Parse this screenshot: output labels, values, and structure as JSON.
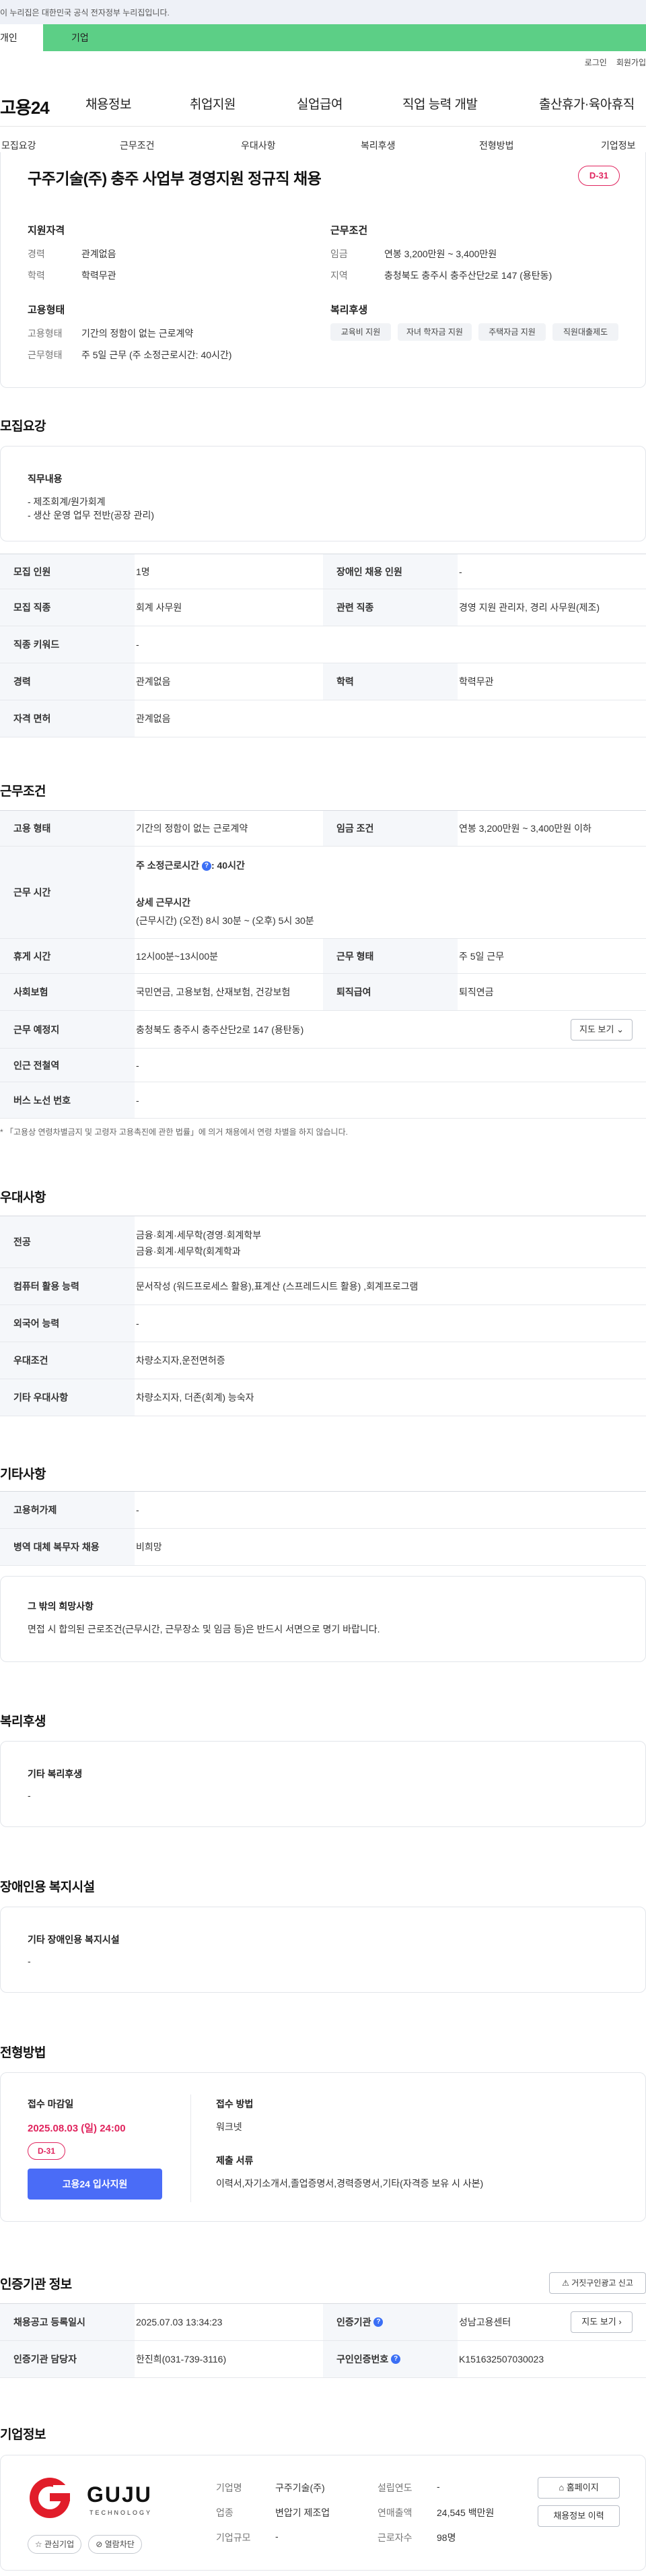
{
  "gov_banner": "이 누리집은 대한민국 공식 전자정부 누리집입니다.",
  "user_tabs": [
    "개인",
    "기업"
  ],
  "util_links": [
    "로그인",
    "회원가입"
  ],
  "logo": "고용24",
  "gnb": [
    "채용정보",
    "취업지원",
    "실업급여",
    "직업 능력 개발",
    "출산휴가·육아휴직"
  ],
  "subnav": [
    "모집요강",
    "근무조건",
    "우대사항",
    "복리후생",
    "전형방법",
    "기업정보"
  ],
  "job": {
    "title": "구주기술(주) 충주 사업부 경영지원 정규직 채용",
    "dday": "D-31",
    "qual_title": "지원자격",
    "qual": [
      {
        "k": "경력",
        "v": "관계없음"
      },
      {
        "k": "학력",
        "v": "학력무관"
      }
    ],
    "emp_title": "고용형태",
    "emp": [
      {
        "k": "고용형태",
        "v": "기간의 정함이 없는 근로계약"
      },
      {
        "k": "근무형태",
        "v": "주 5일 근무 (주 소정근로시간: 40시간)"
      }
    ],
    "cond_title": "근무조건",
    "cond": [
      {
        "k": "임금",
        "v": "연봉 3,200만원 ~ 3,400만원"
      },
      {
        "k": "지역",
        "v": "충청북도 충주시 충주산단2로 147 (용탄동)"
      }
    ],
    "welfare_title": "복리후생",
    "welfare_chips": [
      "교육비 지원",
      "자녀 학자금 지원",
      "주택자금 지원",
      "직원대출제도"
    ]
  },
  "recruit": {
    "heading": "모집요강",
    "duty_title": "직무내용",
    "duty_lines": [
      "- 제조회계/원가회계",
      "- 생산 운영 업무 전반(공장 관리)"
    ],
    "rows": [
      {
        "k1": "모집 인원",
        "v1": "1명",
        "k2": "장애인 채용 인원",
        "v2": "-"
      },
      {
        "k1": "모집 직종",
        "v1": "회계 사무원",
        "k2": "관련 직종",
        "v2": "경영 지원 관리자, 경리 사무원(제조)"
      },
      {
        "k1": "직종 키워드",
        "v1": "-"
      },
      {
        "k1": "경력",
        "v1": "관계없음",
        "k2": "학력",
        "v2": "학력무관"
      },
      {
        "k1": "자격 면허",
        "v1": "관계없음"
      }
    ]
  },
  "work": {
    "heading": "근무조건",
    "emp_type_k": "고용 형태",
    "emp_type_v": "기간의 정함이 없는 근로계약",
    "wage_k": "임금 조건",
    "wage_v": "연봉 3,200만원 ~ 3,400만원 이하",
    "hours_k": "근무 시간",
    "hours_l1": "주 소정근로시간",
    "hours_l1_v": ": 40시간",
    "hours_l2": "상세 근무시간",
    "hours_l3": "(근무시간) (오전) 8시 30분 ~ (오후) 5시 30분",
    "rest_k": "휴게 시간",
    "rest_v": "12시00분~13시00분",
    "form_k": "근무 형태",
    "form_v": "주 5일 근무",
    "ins_k": "사회보험",
    "ins_v": "국민연금, 고용보험, 산재보험, 건강보험",
    "ret_k": "퇴직급여",
    "ret_v": "퇴직연금",
    "place_k": "근무 예정지",
    "place_v": "충청북도 충주시 충주산단2로 147 (용탄동)",
    "map_btn": "지도 보기",
    "sub_k": "인근 전철역",
    "sub_v": "-",
    "bus_k": "버스 노선 번호",
    "bus_v": "-",
    "note": "「고용상 연령차별금지 및 고령자 고용촉진에 관한 법률」에 의거 채용에서 연령 차별을 하지 않습니다."
  },
  "pref": {
    "heading": "우대사항",
    "rows": [
      {
        "k": "전공",
        "v": "금융·회계·세무학(경영·회계학부",
        "v2": "금융·회계·세무학(회계학과"
      },
      {
        "k": "컴퓨터 활용 능력",
        "v": "문서작성 (워드프로세스 활용),표계산 (스프레드시트 활용) ,회계프로그램"
      },
      {
        "k": "외국어 능력",
        "v": "-"
      },
      {
        "k": "우대조건",
        "v": "차량소지자,운전면허증"
      },
      {
        "k": "기타 우대사항",
        "v": "차량소지자, 더존(회계) 능숙자"
      }
    ]
  },
  "etc": {
    "heading": "기타사항",
    "rows": [
      {
        "k": "고용허가제",
        "v": "-"
      },
      {
        "k": "병역 대체 복무자 채용",
        "v": "비희망"
      }
    ],
    "box_title": "그 밖의 희망사항",
    "box_text": "면접 시 합의된 근로조건(근무시간, 근무장소 및 임금 등)은 반드시 서면으로 명기 바랍니다."
  },
  "welfare": {
    "heading": "복리후생",
    "box_title": "기타 복리후생",
    "box_text": "-"
  },
  "disabled": {
    "heading": "장애인용 복지시설",
    "box_title": "기타 장애인용 복지시설",
    "box_text": "-"
  },
  "process": {
    "heading": "전형방법",
    "deadline_title": "접수 마감일",
    "deadline": "2025.08.03 (일) 24:00",
    "dday": "D-31",
    "apply_btn": "고용24 입사지원",
    "method_title": "접수 방법",
    "method": "워크넷",
    "docs_title": "제출 서류",
    "docs": "이력서,자기소개서,졸업증명서,경력증명서,기타(자격증 보유 시 사본)"
  },
  "cert": {
    "heading": "인증기관 정보",
    "report_btn": "거짓구인광고 신고",
    "reg_k": "채용공고 등록일시",
    "reg_v": "2025.07.03 13:34:23",
    "org_k": "인증기관",
    "org_v": "성남고용센터",
    "map_btn": "지도 보기",
    "mgr_k": "인증기관 담당자",
    "mgr_v": "한진희(031-739-3116)",
    "id_k": "구인인증번호",
    "id_v": "K151632507030023"
  },
  "company": {
    "heading": "기업정보",
    "logo_text": "GUJU",
    "logo_sub": "TECHNOLOGY",
    "fav_btn": "관심기업",
    "block_btn": "열람차단",
    "fields": [
      {
        "k": "기업명",
        "v": "구주기술(주)",
        "k2": "설립연도",
        "v2": "-"
      },
      {
        "k": "업종",
        "v": "변압기 제조업",
        "k2": "연매출액",
        "v2": "24,545 백만원"
      },
      {
        "k": "기업규모",
        "v": "-",
        "k2": "근로자수",
        "v2": "98명"
      }
    ],
    "home_btn": "홈페이지",
    "hist_btn": "채용정보 이력"
  },
  "colors": {
    "accent": "#4a6cf7",
    "dday": "#e0245e",
    "green_tab": "#5ccf86"
  }
}
